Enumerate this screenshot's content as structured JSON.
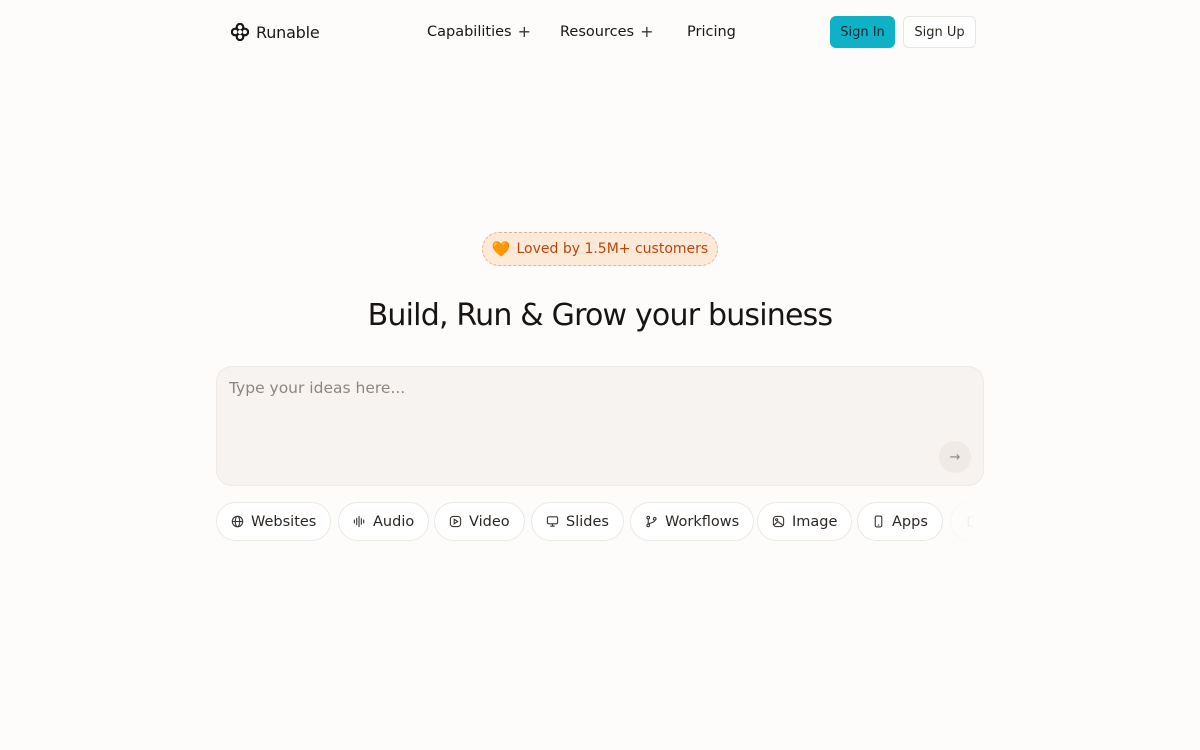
{
  "header": {
    "brand": {
      "name": "Runable",
      "icon": "four-dot-flower-icon"
    },
    "nav": [
      {
        "label": "Capabilities",
        "has_plus": true
      },
      {
        "label": "Resources",
        "has_plus": true
      },
      {
        "label": "Pricing",
        "has_plus": false
      }
    ],
    "plus_glyph": "+",
    "sign_in_label": "Sign In",
    "sign_up_label": "Sign Up"
  },
  "hero": {
    "badge": {
      "heart_glyph": "🧡",
      "text": "Loved by 1.5M+ customers"
    },
    "headline": "Build, Run & Grow your business",
    "prompt": {
      "placeholder": "Type your ideas here...",
      "value": "",
      "send_glyph": "→"
    }
  },
  "chips": [
    {
      "label": "Websites",
      "icon": "globe-icon"
    },
    {
      "label": "Audio",
      "icon": "waveform-icon"
    },
    {
      "label": "Video",
      "icon": "video-icon"
    },
    {
      "label": "Slides",
      "icon": "monitor-icon"
    },
    {
      "label": "Workflows",
      "icon": "git-branch-icon"
    },
    {
      "label": "Image",
      "icon": "image-icon"
    },
    {
      "label": "Apps",
      "icon": "smartphone-icon"
    },
    {
      "label": "",
      "icon": "partial-chip-icon"
    }
  ],
  "colors": {
    "background": "#fdfcfb",
    "accent": "#0fb1c6",
    "badge_bg": "#fde9d8",
    "badge_text": "#b8470e",
    "prompt_bg": "#f7f3f0"
  }
}
